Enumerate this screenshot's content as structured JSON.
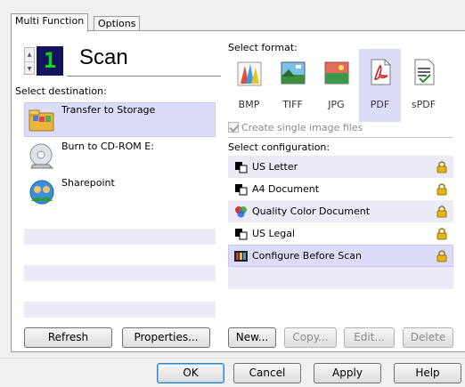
{
  "tabs": [
    {
      "label": "Multi Function",
      "active": true
    },
    {
      "label": "Options",
      "active": false
    }
  ],
  "scan": {
    "digit": "1",
    "title": "Scan"
  },
  "destination": {
    "heading": "Select destination:",
    "items": [
      {
        "label": "Transfer to Storage",
        "icon": "folder-storage-icon",
        "selected": true
      },
      {
        "label": "Burn to CD-ROM  E:",
        "icon": "cd-rom-icon",
        "selected": false
      },
      {
        "label": "Sharepoint",
        "icon": "sharepoint-icon",
        "selected": false
      }
    ],
    "refresh_label": "Refresh",
    "properties_label": "Properties..."
  },
  "format": {
    "heading": "Select format:",
    "items": [
      {
        "label": "BMP",
        "icon": "bmp-paint-icon",
        "selected": false
      },
      {
        "label": "TIFF",
        "icon": "tiff-image-icon",
        "selected": false
      },
      {
        "label": "JPG",
        "icon": "jpg-image-icon",
        "selected": false
      },
      {
        "label": "PDF",
        "icon": "pdf-document-icon",
        "selected": true
      },
      {
        "label": "sPDF",
        "icon": "spdf-document-icon",
        "selected": false
      }
    ],
    "single_image_label": "Create single image files",
    "single_image_checked": true,
    "single_image_enabled": false
  },
  "configuration": {
    "heading": "Select configuration:",
    "items": [
      {
        "label": "US Letter",
        "icon": "bw-document-icon",
        "locked": true,
        "selected": false
      },
      {
        "label": "A4 Document",
        "icon": "bw-document-icon",
        "locked": true,
        "selected": false
      },
      {
        "label": "Quality Color Document",
        "icon": "color-document-icon",
        "locked": true,
        "selected": false
      },
      {
        "label": "US Legal",
        "icon": "bw-document-icon",
        "locked": true,
        "selected": false
      },
      {
        "label": "Configure Before Scan",
        "icon": "configure-scan-icon",
        "locked": true,
        "selected": true
      }
    ],
    "new_label": "New...",
    "copy_label": "Copy...",
    "edit_label": "Edit...",
    "delete_label": "Delete"
  },
  "footer": {
    "ok_label": "OK",
    "cancel_label": "Cancel",
    "apply_label": "Apply",
    "help_label": "Help"
  },
  "colors": {
    "selection": "#dcdcf8",
    "alt_row": "#ebebf7",
    "digit_bg": "#14145e",
    "digit_fg": "#00e000",
    "lock": "#e2b614"
  }
}
